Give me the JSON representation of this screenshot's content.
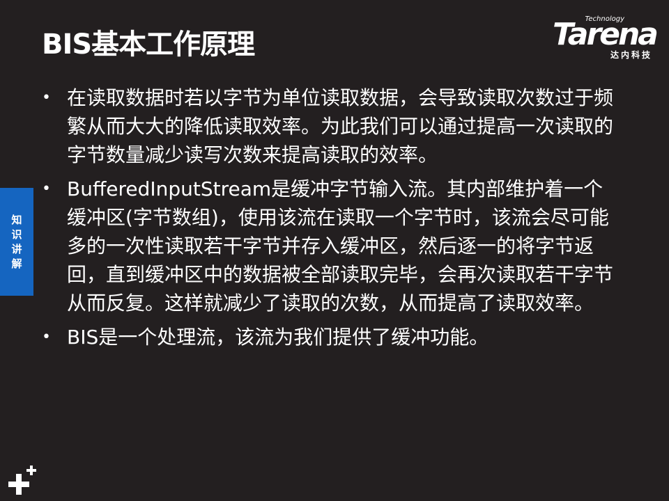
{
  "slide": {
    "title": "BIS基本工作原理",
    "logo": {
      "brand": "Tarena",
      "tagline": "Technology",
      "chinese": "达内科技"
    },
    "side_tab": [
      "知",
      "识",
      "讲",
      "解"
    ],
    "bullets": [
      "在读取数据时若以字节为单位读取数据，会导致读取次数过于频繁从而大大的降低读取效率。为此我们可以通过提高一次读取的字节数量减少读写次数来提高读取的效率。",
      "BufferedInputStream是缓冲字节输入流。其内部维护着一个缓冲区(字节数组)，使用该流在读取一个字节时，该流会尽可能多的一次性读取若干字节并存入缓冲区，然后逐一的将字节返回，直到缓冲区中的数据被全部读取完毕，会再次读取若干字节从而反复。这样就减少了读取的次数，从而提高了读取效率。",
      "BIS是一个处理流，该流为我们提供了缓冲功能。"
    ],
    "bullet_glyph": "•"
  },
  "colors": {
    "background": "#231f20",
    "text": "#ffffff",
    "side_tab": "#1565c0"
  },
  "icons": [
    "plus-icon"
  ]
}
